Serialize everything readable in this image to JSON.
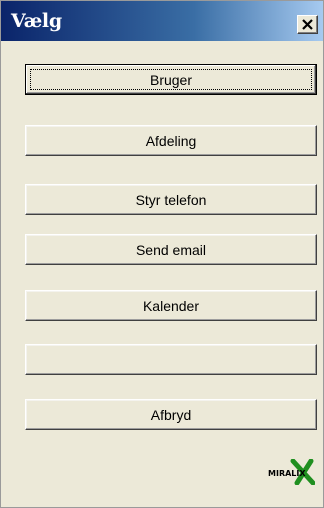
{
  "window": {
    "title": "Vælg",
    "close_icon": "close-icon"
  },
  "buttons": {
    "bruger": "Bruger",
    "afdeling": "Afdeling",
    "styr_telefon": "Styr telefon",
    "send_email": "Send email",
    "kalender": "Kalender",
    "blank": "",
    "afbryd": "Afbryd"
  },
  "logo": {
    "text": "MIRALIX",
    "accent_color": "#1f8f1f"
  }
}
